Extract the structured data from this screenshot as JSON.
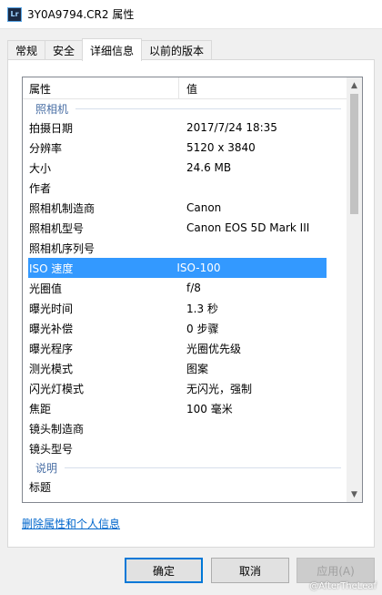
{
  "window": {
    "icon_text": "Lr",
    "title": "3Y0A9794.CR2 属性"
  },
  "tabs": [
    {
      "label": "常规"
    },
    {
      "label": "安全"
    },
    {
      "label": "详细信息"
    },
    {
      "label": "以前的版本"
    }
  ],
  "list": {
    "header": {
      "property": "属性",
      "value": "值"
    },
    "group_camera": "照相机",
    "rows": [
      {
        "k": "拍摄日期",
        "v": "2017/7/24 18:35"
      },
      {
        "k": "分辨率",
        "v": "5120 x 3840"
      },
      {
        "k": "大小",
        "v": "24.6 MB"
      },
      {
        "k": "作者",
        "v": ""
      },
      {
        "k": "照相机制造商",
        "v": "Canon"
      },
      {
        "k": "照相机型号",
        "v": "Canon EOS 5D Mark III"
      },
      {
        "k": "照相机序列号",
        "v": ""
      },
      {
        "k": "ISO 速度",
        "v": "ISO-100"
      },
      {
        "k": "光圈值",
        "v": "f/8"
      },
      {
        "k": "曝光时间",
        "v": "1.3 秒"
      },
      {
        "k": "曝光补偿",
        "v": "0 步骤"
      },
      {
        "k": "曝光程序",
        "v": "光圈优先级"
      },
      {
        "k": "测光模式",
        "v": "图案"
      },
      {
        "k": "闪光灯模式",
        "v": "无闪光，强制"
      },
      {
        "k": "焦距",
        "v": "100 毫米"
      },
      {
        "k": "镜头制造商",
        "v": ""
      },
      {
        "k": "镜头型号",
        "v": ""
      }
    ],
    "group_desc": "说明",
    "last_row": {
      "k": "标题",
      "v": ""
    }
  },
  "remove_link": "删除属性和个人信息",
  "buttons": {
    "ok": "确定",
    "cancel": "取消",
    "apply": "应用(A)"
  },
  "watermark": "@AfterTheLeaf",
  "colors": {
    "selection": "#3399ff",
    "link": "#0066cc",
    "accent": "#0078d7"
  }
}
